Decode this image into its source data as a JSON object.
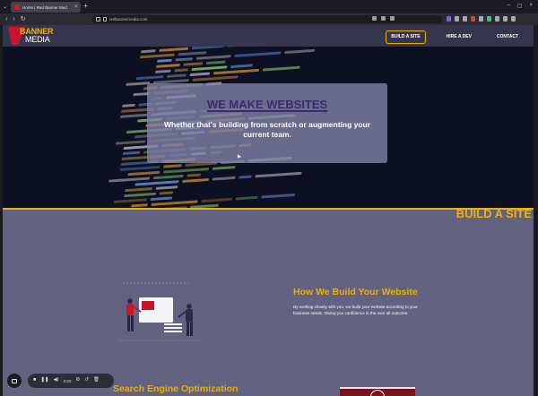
{
  "browser": {
    "tab_title": "Home | Red Banner Med",
    "tab_close": "×",
    "new_tab": "+",
    "tab_list": "⌄",
    "window_controls": [
      "–",
      "▢",
      "×"
    ],
    "url": "redbannermedia.com",
    "nav": {
      "back": "‹",
      "forward": "›",
      "reload": "↻"
    }
  },
  "site": {
    "logo": {
      "line1": "BANNER",
      "line2": "MEDIA"
    },
    "nav": [
      {
        "label": "BUILD A SITE",
        "active": true
      },
      {
        "label": "HIRE A DEV",
        "active": false
      },
      {
        "label": "CONTACT",
        "active": false
      }
    ],
    "hero": {
      "heading": "WE MAKE WEBSITES",
      "subheading": "Whether that's building from scratch or augmenting your current team."
    },
    "section_title": "BUILD A SITE",
    "how": {
      "title": "How We Build Your Website",
      "body": "By working closely with you, we build your website according to your business needs. Giving you confidence in the over all outcome."
    },
    "seo_title": "Search Engine Optimization"
  },
  "recorder": {
    "time": "0:00",
    "buttons": [
      "■",
      "❚❚",
      "◀)",
      "⚙",
      "↺",
      "🗑"
    ]
  },
  "colors": {
    "accent": "#e9b10c",
    "brand_red": "#c8152a",
    "hero_heading": "#3a2c6b",
    "section_bg": "#646281"
  }
}
